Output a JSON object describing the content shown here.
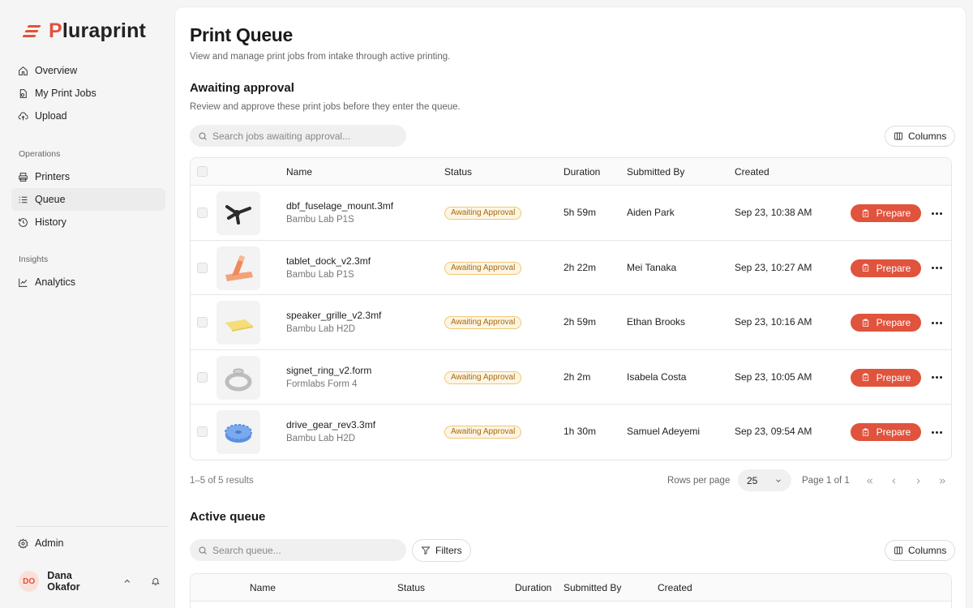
{
  "brand": {
    "name_prefix": "P",
    "name_rest": "luraprint",
    "accent": "#e0533d"
  },
  "sidebar": {
    "nav_main": [
      {
        "label": "Overview",
        "icon": "home-icon"
      },
      {
        "label": "My Print Jobs",
        "icon": "jobs-icon"
      },
      {
        "label": "Upload",
        "icon": "upload-icon"
      }
    ],
    "operations_label": "Operations",
    "nav_operations": [
      {
        "label": "Printers",
        "icon": "printer-icon"
      },
      {
        "label": "Queue",
        "icon": "queue-icon",
        "active": true
      },
      {
        "label": "History",
        "icon": "history-icon"
      }
    ],
    "insights_label": "Insights",
    "nav_insights": [
      {
        "label": "Analytics",
        "icon": "analytics-icon"
      }
    ],
    "admin_label": "Admin",
    "user": {
      "initials": "DO",
      "name": "Dana Okafor"
    }
  },
  "page": {
    "title": "Print Queue",
    "subtitle": "View and manage print jobs from intake through active printing."
  },
  "awaiting": {
    "title": "Awaiting approval",
    "subtitle": "Review and approve these print jobs before they enter the queue.",
    "search_placeholder": "Search jobs awaiting approval...",
    "columns_label": "Columns",
    "headers": {
      "name": "Name",
      "status": "Status",
      "duration": "Duration",
      "submitted_by": "Submitted By",
      "created": "Created"
    },
    "rows": [
      {
        "name": "dbf_fuselage_mount.3mf",
        "printer": "Bambu Lab P1S",
        "status": "Awaiting Approval",
        "duration": "5h 59m",
        "submitted_by": "Aiden Park",
        "created": "Sep 23, 10:38 AM",
        "action": "Prepare"
      },
      {
        "name": "tablet_dock_v2.3mf",
        "printer": "Bambu Lab P1S",
        "status": "Awaiting Approval",
        "duration": "2h 22m",
        "submitted_by": "Mei Tanaka",
        "created": "Sep 23, 10:27 AM",
        "action": "Prepare"
      },
      {
        "name": "speaker_grille_v2.3mf",
        "printer": "Bambu Lab H2D",
        "status": "Awaiting Approval",
        "duration": "2h 59m",
        "submitted_by": "Ethan Brooks",
        "created": "Sep 23, 10:16 AM",
        "action": "Prepare"
      },
      {
        "name": "signet_ring_v2.form",
        "printer": "Formlabs Form 4",
        "status": "Awaiting Approval",
        "duration": "2h 2m",
        "submitted_by": "Isabela Costa",
        "created": "Sep 23, 10:05 AM",
        "action": "Prepare"
      },
      {
        "name": "drive_gear_rev3.3mf",
        "printer": "Bambu Lab H2D",
        "status": "Awaiting Approval",
        "duration": "1h 30m",
        "submitted_by": "Samuel Adeyemi",
        "created": "Sep 23, 09:54 AM",
        "action": "Prepare"
      }
    ],
    "results_text": "1–5 of 5 results",
    "rows_per_page_label": "Rows per page",
    "rows_per_page_value": "25",
    "page_text": "Page 1 of 1"
  },
  "active": {
    "title": "Active queue",
    "search_placeholder": "Search queue...",
    "filters_label": "Filters",
    "columns_label": "Columns",
    "headers": {
      "name": "Name",
      "status": "Status",
      "duration": "Duration",
      "submitted_by": "Submitted By",
      "created": "Created"
    }
  },
  "colors": {
    "badge_border": "#f0c777",
    "badge_bg": "#fdf5e3",
    "badge_text": "#a76a10",
    "sidebar_bg": "#f5f5f5"
  }
}
